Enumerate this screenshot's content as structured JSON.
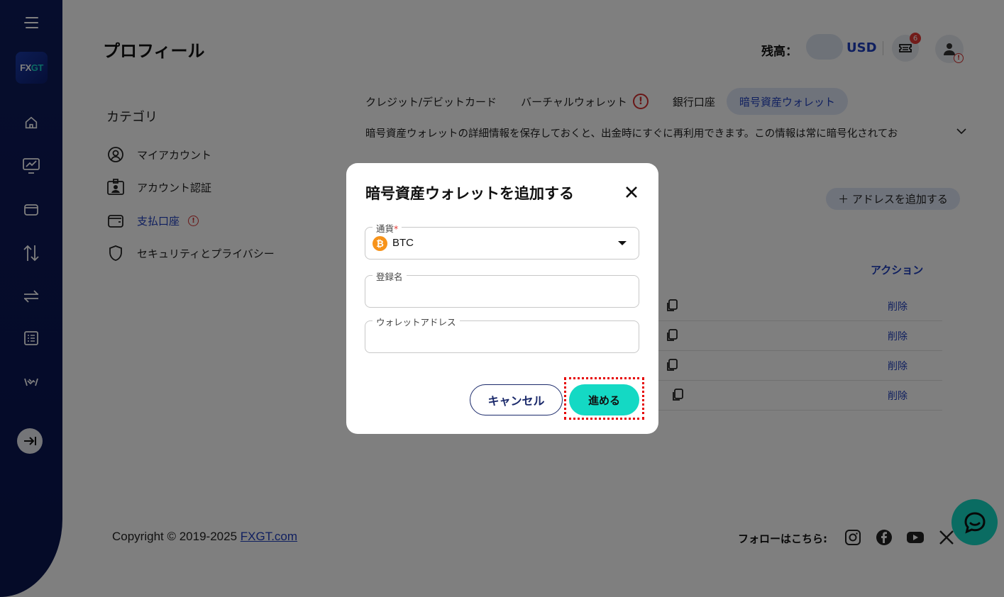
{
  "header": {
    "page_title": "プロフィール",
    "balance_label": "残高：",
    "balance_currency": "USD",
    "notification_count": "6"
  },
  "category": {
    "title": "カテゴリ",
    "items": [
      {
        "label": "マイアカウント",
        "icon": "user-circle-icon"
      },
      {
        "label": "アカウント認証",
        "icon": "id-badge-icon"
      },
      {
        "label": "支払口座",
        "icon": "wallet-icon",
        "active": true
      },
      {
        "label": "セキュリティとプライバシー",
        "icon": "shield-icon"
      }
    ]
  },
  "tabs": [
    {
      "label": "クレジット/デビットカード"
    },
    {
      "label": "バーチャルウォレット"
    },
    {
      "label": "銀行口座"
    },
    {
      "label": "暗号資産ウォレット",
      "active": true
    }
  ],
  "info_text": "暗号資産ウォレットの詳細情報を保存しておくと、出金時にすぐに再利用できます。この情報は常に暗号化されてお",
  "add_address_label": "＋ アドレスを追加する",
  "table": {
    "action_header": "アクション",
    "rows": [
      {
        "action": "削除"
      },
      {
        "action": "削除"
      },
      {
        "action": "削除"
      },
      {
        "action": "削除"
      }
    ]
  },
  "footer": {
    "copyright": "Copyright © 2019-2025 ",
    "link": "FXGT.com",
    "follow_label": "フォローはこちら:"
  },
  "sidebar": {
    "logo_left": "FX",
    "logo_right": "GT"
  },
  "modal": {
    "title": "暗号資産ウォレットを追加する",
    "currency_label": "通貨",
    "currency_required": "*",
    "currency_value": "BTC",
    "coin_symbol": "₿",
    "name_label": "登録名",
    "name_value": "",
    "address_label": "ウォレットアドレス",
    "address_value": "",
    "cancel_label": "キャンセル",
    "proceed_label": "進める"
  },
  "colors": {
    "accent": "#14d9c4",
    "brand_blue": "#1f3fbf",
    "sidebar": "#0d1b5a",
    "btc": "#f7931a"
  }
}
